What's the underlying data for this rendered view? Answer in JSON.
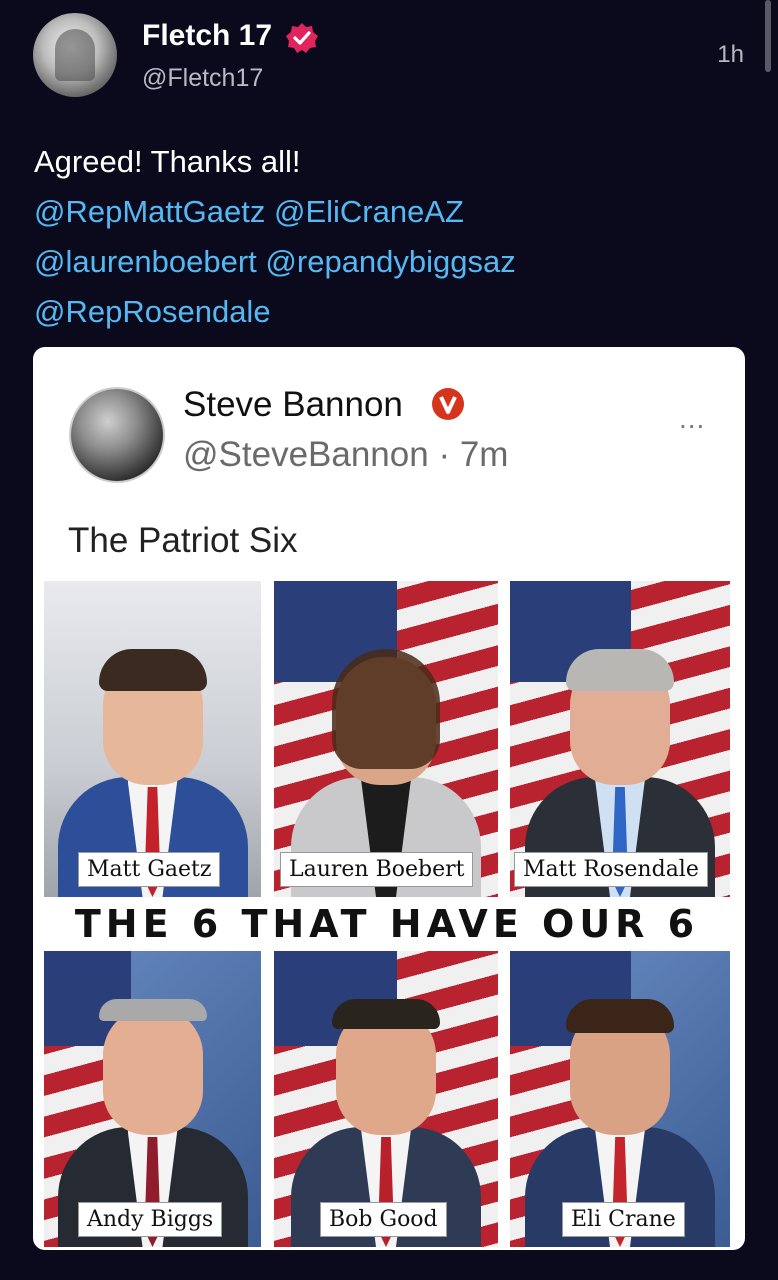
{
  "post": {
    "author_name": "Fletch 17",
    "author_handle": "@Fletch17",
    "timestamp": "1h",
    "text_intro": "Agreed! Thanks all!",
    "mentions": [
      "@RepMattGaetz",
      "@EliCraneAZ",
      "@laurenboebert",
      "@repandybiggsaz",
      "@RepRosendale"
    ]
  },
  "embedded": {
    "author_name": "Steve Bannon",
    "author_handle": "@SteveBannon",
    "time_sep": "·",
    "time": "7m",
    "more": "...",
    "text": "The Patriot Six",
    "banner": "THE 6 THAT HAVE OUR 6",
    "people": [
      "Matt Gaetz",
      "Lauren Boebert",
      "Matt Rosendale",
      "Andy Biggs",
      "Bob Good",
      "Eli Crane"
    ]
  },
  "colors": {
    "background": "#0b0a1c",
    "mention": "#55b8f2",
    "verified_badge": "#e0245e",
    "bannon_badge": "#d4351c"
  },
  "icons": {
    "verified": "verified-badge-icon",
    "more": "more-options-icon"
  }
}
